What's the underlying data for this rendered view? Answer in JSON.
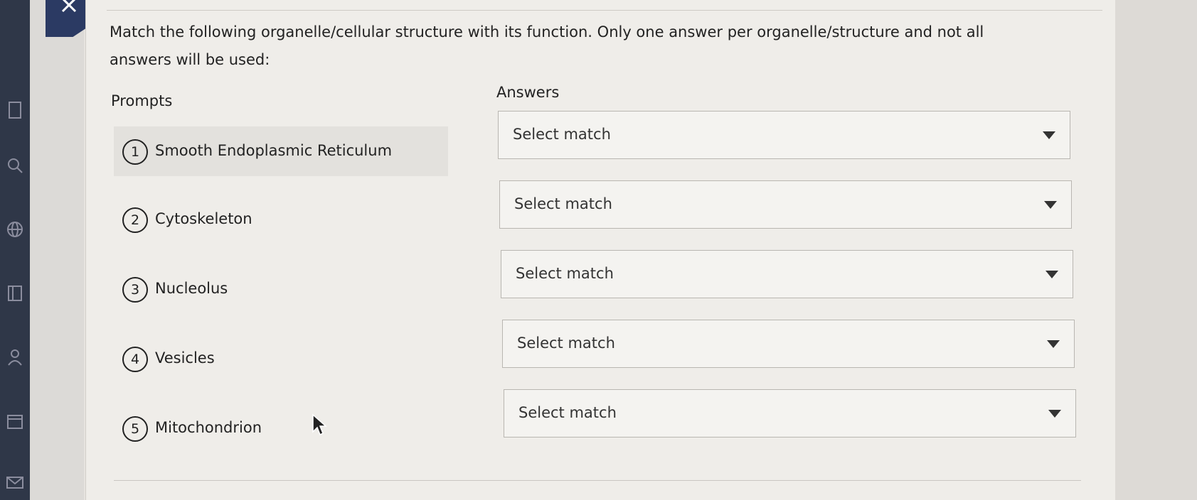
{
  "question": "Match the following organelle/cellular structure with its function. Only one answer per organelle/structure and not all answers will be used:",
  "headers": {
    "prompts": "Prompts",
    "answers": "Answers"
  },
  "prompts": [
    {
      "number": "1",
      "label": "Smooth Endoplasmic Reticulum"
    },
    {
      "number": "2",
      "label": "Cytoskeleton"
    },
    {
      "number": "3",
      "label": "Nucleolus"
    },
    {
      "number": "4",
      "label": "Vesicles"
    },
    {
      "number": "5",
      "label": "Mitochondrion"
    }
  ],
  "answers": [
    {
      "selected": "Select match"
    },
    {
      "selected": "Select match"
    },
    {
      "selected": "Select match"
    },
    {
      "selected": "Select match"
    },
    {
      "selected": "Select match"
    }
  ],
  "icons": {
    "close": "close-icon",
    "sidebar": [
      "document-icon",
      "search-icon",
      "globe-icon",
      "book-icon",
      "people-icon",
      "calendar-icon",
      "mail-icon"
    ],
    "dropdown": "chevron-down-icon",
    "cursor": "mouse-pointer-icon"
  },
  "colors": {
    "sidebar": "#2f3748",
    "close_tab": "#2b3a63",
    "panel": "#efede9"
  }
}
